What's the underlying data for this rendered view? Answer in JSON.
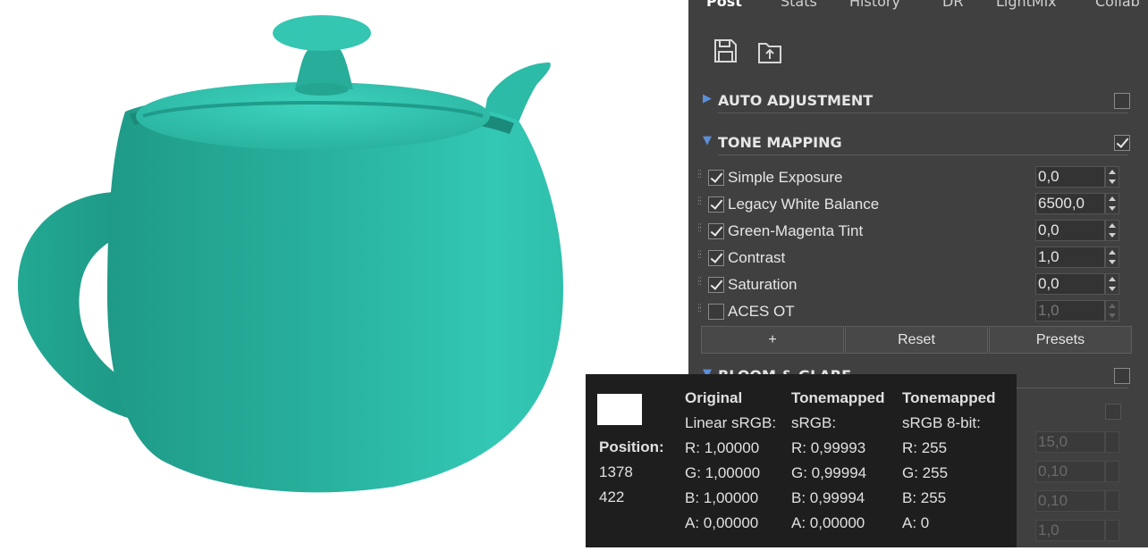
{
  "tabs": [
    "Post",
    "Stats",
    "History",
    "DR",
    "LightMix",
    "Collab"
  ],
  "active_tab": "Post",
  "toolbar": {
    "save_icon": "save-icon",
    "export_icon": "export-icon"
  },
  "sections": {
    "auto_adjustment": {
      "title": "AUTO ADJUSTMENT",
      "expanded": false,
      "enabled": false
    },
    "tone_mapping": {
      "title": "TONE MAPPING",
      "expanded": true,
      "enabled": true
    },
    "bloom_glare": {
      "title": "BLOOM & GLARE",
      "expanded": true,
      "enabled": false
    }
  },
  "tone_mapping_rows": [
    {
      "label": "Simple Exposure",
      "value": "0,0",
      "checked": true,
      "enabled": true
    },
    {
      "label": "Legacy White Balance",
      "value": "6500,0",
      "checked": true,
      "enabled": true
    },
    {
      "label": "Green-Magenta Tint",
      "value": "0,0",
      "checked": true,
      "enabled": true
    },
    {
      "label": "Contrast",
      "value": "1,0",
      "checked": true,
      "enabled": true
    },
    {
      "label": "Saturation",
      "value": "0,0",
      "checked": true,
      "enabled": true
    },
    {
      "label": "ACES OT",
      "value": "1,0",
      "checked": false,
      "enabled": false
    }
  ],
  "buttons": {
    "add": "+",
    "reset": "Reset",
    "presets": "Presets"
  },
  "bloom_fields": [
    "15,0",
    "0,10",
    "0,10",
    "1,0"
  ],
  "tooltip": {
    "swatch_color": "#ffffff",
    "position_label": "Position:",
    "position_x": "1378",
    "position_y": "422",
    "original": {
      "header": "Original",
      "space": "Linear sRGB:",
      "r": "R: 1,00000",
      "g": "G: 1,00000",
      "b": "B: 1,00000",
      "a": "A: 0,00000"
    },
    "tonemapped": {
      "header": "Tonemapped",
      "space": "sRGB:",
      "r": "R: 0,99993",
      "g": "G: 0,99994",
      "b": "B: 0,99994",
      "a": "A: 0,00000"
    },
    "tonemapped8": {
      "header": "Tonemapped",
      "space": "sRGB 8-bit:",
      "r": "R: 255",
      "g": "G: 255",
      "b": "B: 255",
      "a": "A: 0"
    }
  },
  "colors": {
    "panel_bg": "#404040",
    "teapot": "#2ebfa8",
    "tooltip_bg": "#1e1e1e",
    "section_arrow": "#5b8fd8"
  }
}
